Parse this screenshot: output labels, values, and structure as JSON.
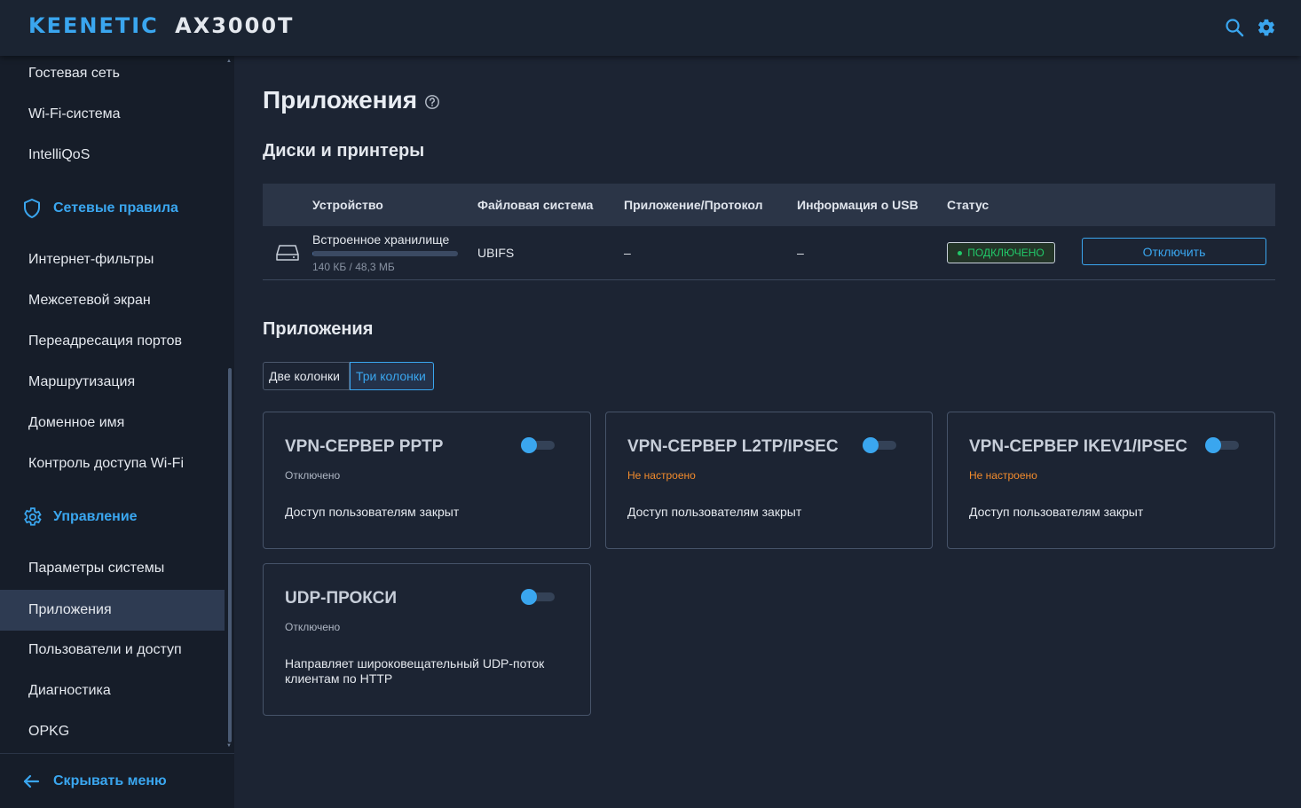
{
  "header": {
    "brand": "KEENETIC AX3000T",
    "search_icon": "search-icon",
    "settings_icon": "gear-icon",
    "accent_color": "#3aa6ef"
  },
  "sidebar": {
    "top_items": [
      "Гостевая сеть",
      "Wi-Fi-система",
      "IntelliQoS"
    ],
    "group_network_rules": {
      "label": "Сетевые правила",
      "icon": "shield-icon",
      "items": [
        "Интернет-фильтры",
        "Межсетевой экран",
        "Переадресация портов",
        "Маршрутизация",
        "Доменное имя",
        "Контроль доступа Wi-Fi"
      ]
    },
    "group_management": {
      "label": "Управление",
      "icon": "gear-icon",
      "items": [
        "Параметры системы",
        "Приложения",
        "Пользователи и доступ",
        "Диагностика",
        "OPKG"
      ],
      "active_item": "Приложения"
    },
    "hide_menu_label": "Скрывать меню",
    "hide_menu_icon": "arrow-left-icon"
  },
  "main": {
    "title": "Приложения",
    "title_icon": "help-icon",
    "disks_section_title": "Диски и принтеры",
    "table": {
      "headers": [
        "Устройство",
        "Файловая система",
        "Приложение/Протокол",
        "Информация о USB",
        "Статус"
      ],
      "rows": [
        {
          "device_icon": "hard-drive-icon",
          "device": "Встроенное хранилище",
          "usage": "140 КБ / 48,3 МБ",
          "usage_fraction": 0.003,
          "filesystem": "UBIFS",
          "protocol": "–",
          "usb_info": "–",
          "status": "ПОДКЛЮЧЕНО",
          "action": "Отключить"
        }
      ]
    },
    "apps_section_title": "Приложения",
    "view_toggle": {
      "options": [
        "Две колонки",
        "Три колонки"
      ],
      "selected": "Три колонки"
    },
    "cards": [
      {
        "title": "VPN-СЕРВЕР PPTP",
        "status": "Отключено",
        "status_kind": "off",
        "desc": "Доступ пользователям закрыт",
        "enabled": false
      },
      {
        "title": "VPN-СЕРВЕР L2TP/IPSEC",
        "status": "Не настроено",
        "status_kind": "warn",
        "desc": "Доступ пользователям закрыт",
        "enabled": false
      },
      {
        "title": "VPN-СЕРВЕР IKEV1/IPSEC",
        "status": "Не настроено",
        "status_kind": "warn",
        "desc": "Доступ пользователям закрыт",
        "enabled": false
      },
      {
        "title": "UDP-ПРОКСИ",
        "status": "Отключено",
        "status_kind": "off",
        "desc": "Направляет широковещательный UDP-поток клиентам по HTTP",
        "enabled": false
      }
    ]
  }
}
